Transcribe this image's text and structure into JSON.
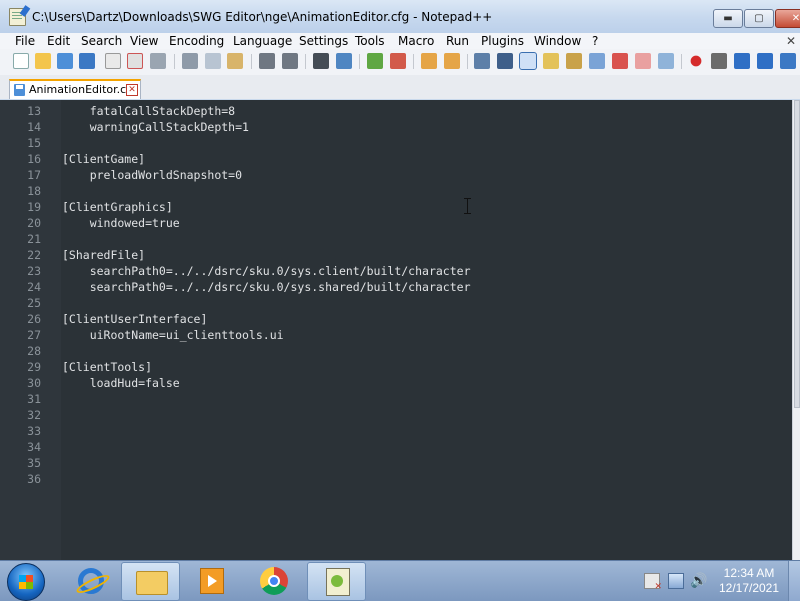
{
  "window": {
    "title": "C:\\Users\\Dartz\\Downloads\\SWG Editor\\nge\\AnimationEditor.cfg - Notepad++",
    "controls": {
      "minimize": "▬",
      "maximize": "▢",
      "close": "✕"
    }
  },
  "menu": [
    "File",
    "Edit",
    "Search",
    "View",
    "Encoding",
    "Language",
    "Settings",
    "Tools",
    "Macro",
    "Run",
    "Plugins",
    "Window",
    "?"
  ],
  "menu_close": "✕",
  "toolbar_icons": [
    "new-file-icon",
    "open-file-icon",
    "save-icon",
    "save-all-icon",
    "close-icon",
    "close-all-icon",
    "print-icon",
    "cut-icon",
    "copy-icon",
    "paste-icon",
    "undo-icon",
    "redo-icon",
    "find-icon",
    "replace-icon",
    "zoom-in-icon",
    "zoom-out-icon",
    "sync-vertical-icon",
    "sync-horizontal-icon",
    "word-wrap-icon",
    "show-all-characters-icon",
    "indent-guide-icon",
    "doc-map-icon",
    "function-list-icon",
    "folder-as-workspace-icon",
    "monitoring-icon",
    "record-macro-icon",
    "stop-record-icon",
    "play-macro-icon",
    "run-macro-multiple-icon",
    "save-macro-icon"
  ],
  "tab": {
    "label": "AnimationEditor.cfg",
    "close": "✕"
  },
  "editor": {
    "lines": [
      {
        "n": "13",
        "text": "    fatalCallStackDepth=8"
      },
      {
        "n": "14",
        "text": "    warningCallStackDepth=1"
      },
      {
        "n": "15",
        "text": ""
      },
      {
        "n": "16",
        "text": "[ClientGame]"
      },
      {
        "n": "17",
        "text": "    preloadWorldSnapshot=0"
      },
      {
        "n": "18",
        "text": ""
      },
      {
        "n": "19",
        "text": "[ClientGraphics]"
      },
      {
        "n": "20",
        "text": "    windowed=true"
      },
      {
        "n": "21",
        "text": ""
      },
      {
        "n": "22",
        "text": "[SharedFile]"
      },
      {
        "n": "23",
        "text": "    searchPath0=../../dsrc/sku.0/sys.client/built/character"
      },
      {
        "n": "24",
        "text": "    searchPath0=../../dsrc/sku.0/sys.shared/built/character"
      },
      {
        "n": "25",
        "text": ""
      },
      {
        "n": "26",
        "text": "[ClientUserInterface]"
      },
      {
        "n": "27",
        "text": "    uiRootName=ui_clienttools.ui"
      },
      {
        "n": "28",
        "text": ""
      },
      {
        "n": "29",
        "text": "[ClientTools]"
      },
      {
        "n": "30",
        "text": "    loadHud=false"
      },
      {
        "n": "31",
        "text": ""
      },
      {
        "n": "32",
        "text": ""
      },
      {
        "n": "33",
        "text": ""
      },
      {
        "n": "34",
        "text": ""
      },
      {
        "n": "35",
        "text": ""
      },
      {
        "n": "36",
        "text": ""
      }
    ]
  },
  "taskbar": {
    "apps": [
      "internet-explorer-icon",
      "file-explorer-icon",
      "media-player-icon",
      "chrome-icon",
      "notepad-plus-plus-icon"
    ],
    "clock": {
      "time": "12:34 AM",
      "date": "12/17/2021"
    }
  },
  "colors": {
    "editor_bg": "#2b3237",
    "tab_accent": "#f4a300"
  }
}
